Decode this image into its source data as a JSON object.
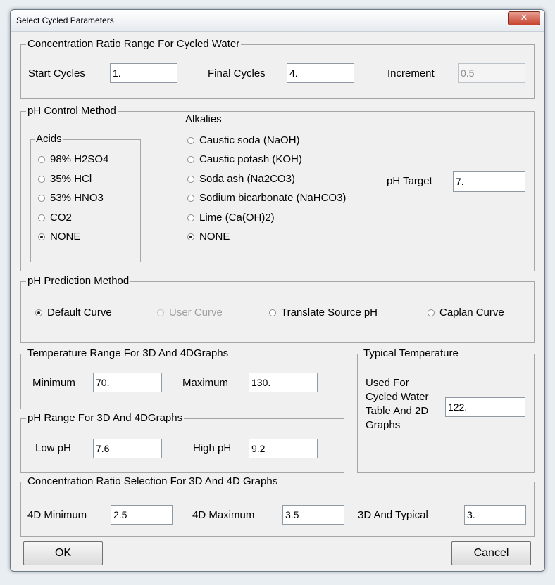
{
  "window": {
    "title": "Select Cycled Parameters",
    "close_glyph": "✕"
  },
  "concentration": {
    "legend": "Concentration Ratio Range For Cycled Water",
    "start_label": "Start Cycles",
    "start_value": "1.",
    "final_label": "Final Cycles",
    "final_value": "4.",
    "increment_label": "Increment",
    "increment_value": "0.5"
  },
  "ph_control": {
    "legend": "pH Control Method",
    "acids": {
      "legend": "Acids",
      "options": [
        "98% H2SO4",
        "35% HCl",
        "53% HNO3",
        "CO2",
        "NONE"
      ],
      "selected": "NONE"
    },
    "alkalies": {
      "legend": "Alkalies",
      "options": [
        "Caustic soda (NaOH)",
        "Caustic potash (KOH)",
        "Soda ash (Na2CO3)",
        "Sodium bicarbonate (NaHCO3)",
        "Lime (Ca(OH)2)",
        "NONE"
      ],
      "selected": "NONE"
    },
    "target_label": "pH Target",
    "target_value": "7."
  },
  "ph_prediction": {
    "legend": "pH Prediction Method",
    "options": [
      "Default Curve",
      "User Curve",
      "Translate Source pH",
      "Caplan Curve"
    ],
    "selected": "Default Curve",
    "disabled": [
      "User Curve"
    ]
  },
  "temperature_range": {
    "legend": "Temperature Range For 3D And 4DGraphs",
    "min_label": "Minimum",
    "min_value": "70.",
    "max_label": "Maximum",
    "max_value": "130."
  },
  "ph_range": {
    "legend": "pH Range For 3D And 4DGraphs",
    "low_label": "Low pH",
    "low_value": "7.6",
    "high_label": "High pH",
    "high_value": "9.2"
  },
  "typical_temperature": {
    "legend": "Typical Temperature",
    "description_lines": [
      "Used For",
      "Cycled Water",
      "Table And 2D",
      "Graphs"
    ],
    "value": "122."
  },
  "ratio_selection": {
    "legend": "Concentration Ratio Selection For 3D And 4D Graphs",
    "min_label": "4D Minimum",
    "min_value": "2.5",
    "max_label": "4D Maximum",
    "max_value": "3.5",
    "typical_label": "3D  And Typical",
    "typical_value": "3."
  },
  "buttons": {
    "ok": "OK",
    "cancel": "Cancel"
  }
}
